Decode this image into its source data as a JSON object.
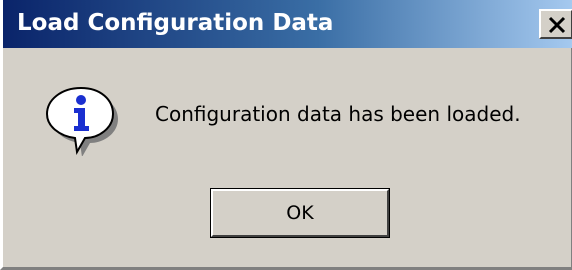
{
  "window": {
    "title": "Load Configuration Data",
    "close_icon": "close-icon"
  },
  "body": {
    "icon": "info-icon",
    "message": "Configuration data has been loaded."
  },
  "buttons": {
    "ok_label": "OK"
  },
  "colors": {
    "titlebar_start": "#0a246a",
    "titlebar_end": "#a6caf0",
    "dialog_bg": "#d4d0c8",
    "icon_blue": "#1a2fd0"
  }
}
